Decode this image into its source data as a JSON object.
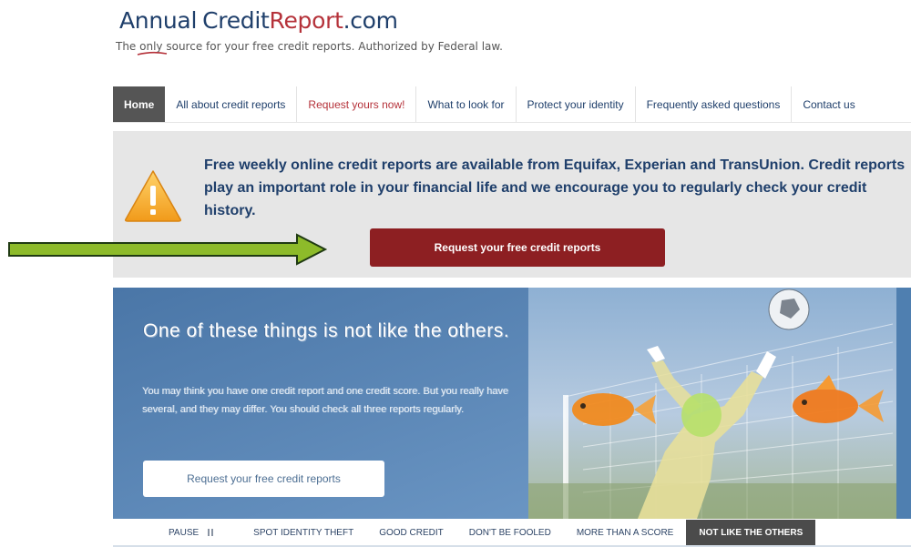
{
  "logo": {
    "word_annual": "Annual",
    "word_credit": "Credit",
    "word_report": "Report",
    "word_tld": ".com"
  },
  "tagline": {
    "before": "The ",
    "emphasis": "only",
    "after": " source for your free credit reports. Authorized by Federal law."
  },
  "nav": {
    "items": [
      {
        "label": "Home"
      },
      {
        "label": "All about credit reports"
      },
      {
        "label": "Request yours now!"
      },
      {
        "label": "What to look for"
      },
      {
        "label": "Protect your identity"
      },
      {
        "label": "Frequently asked questions"
      },
      {
        "label": "Contact us"
      }
    ]
  },
  "alert": {
    "icon": "warning-triangle-icon",
    "message": "Free weekly online credit reports are available from Equifax, Experian and TransUnion. Credit reports play an important role in your financial life and we encourage you to regularly check your credit history.",
    "button_label": "Request your free credit reports"
  },
  "hero": {
    "title": "One of these things is not like the others.",
    "body": "You may think you have one credit report and one credit score. But you really have several, and they may differ. You should check all three reports regularly.",
    "button_label": "Request your free credit reports"
  },
  "carousel_tabs": {
    "pause_label": "PAUSE",
    "items": [
      {
        "label": "SPOT IDENTITY THEFT"
      },
      {
        "label": "GOOD CREDIT"
      },
      {
        "label": "DON'T BE FOOLED"
      },
      {
        "label": "MORE THAN A SCORE"
      },
      {
        "label": "NOT LIKE THE OTHERS"
      }
    ]
  },
  "colors": {
    "navy": "#1f3f6b",
    "brand_red": "#b5323a",
    "button_red": "#8d1f22",
    "arrow_green": "#8dbb2a",
    "hero_blue": "#5b86b4"
  }
}
